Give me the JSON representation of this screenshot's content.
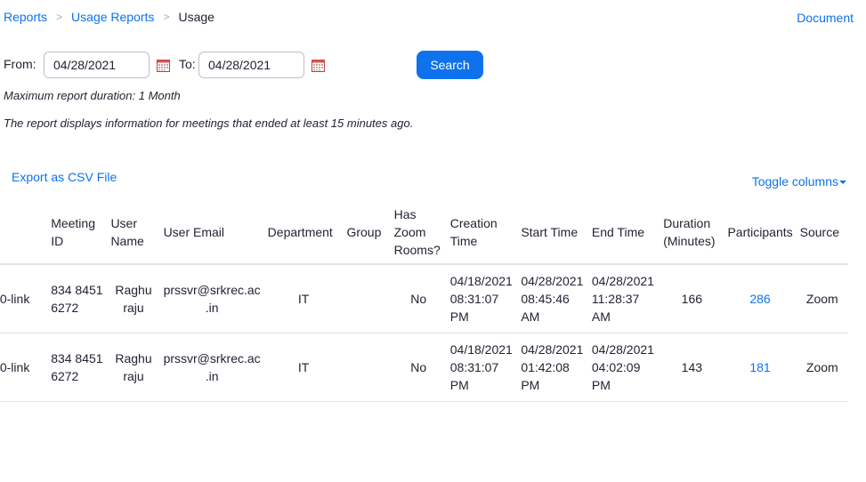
{
  "breadcrumb": {
    "items": [
      "Reports",
      "Usage Reports"
    ],
    "separator": ">",
    "current": "Usage"
  },
  "header": {
    "document_link": "Document"
  },
  "filters": {
    "from_label": "From:",
    "from_value": "04/28/2021",
    "to_label": "To:",
    "to_value": "04/28/2021",
    "search_label": "Search"
  },
  "notes": {
    "max_duration": "Maximum report duration: 1 Month",
    "info": "The report displays information for meetings that ended at least 15 minutes ago."
  },
  "actions": {
    "export_label": "Export as CSV File",
    "toggle_columns_label": "Toggle columns"
  },
  "table": {
    "headers": [
      "",
      "Meeting ID",
      "User Name",
      "User Email",
      "Department",
      "Group",
      "Has Zoom Rooms?",
      "Creation Time",
      "Start Time",
      "End Time",
      "Duration (Minutes)",
      "Participants",
      "Source"
    ],
    "rows": [
      {
        "topic": "0-link",
        "meeting_id": "834 8451 6272",
        "user_name": "Raghu raju",
        "user_email": "prssvr@srkrec.ac .in",
        "department": "IT",
        "group": "",
        "has_zoom_rooms": "No",
        "creation_time": "04/18/2021 08:31:07 PM",
        "start_time": "04/28/2021 08:45:46 AM",
        "end_time": "04/28/2021 11:28:37 AM",
        "duration": "166",
        "participants": "286",
        "source": "Zoom"
      },
      {
        "topic": "0-link",
        "meeting_id": "834 8451 6272",
        "user_name": "Raghu raju",
        "user_email": "prssvr@srkrec.ac .in",
        "department": "IT",
        "group": "",
        "has_zoom_rooms": "No",
        "creation_time": "04/18/2021 08:31:07 PM",
        "start_time": "04/28/2021 01:42:08 PM",
        "end_time": "04/28/2021 04:02:09 PM",
        "duration": "143",
        "participants": "181",
        "source": "Zoom"
      }
    ]
  },
  "colors": {
    "link": "#0e72ed",
    "primary_button": "#0e72ed",
    "text": "#232333",
    "divider": "#e3e3e3"
  },
  "icons": {
    "calendar": "calendar-icon",
    "caret": "caret-down-icon"
  }
}
